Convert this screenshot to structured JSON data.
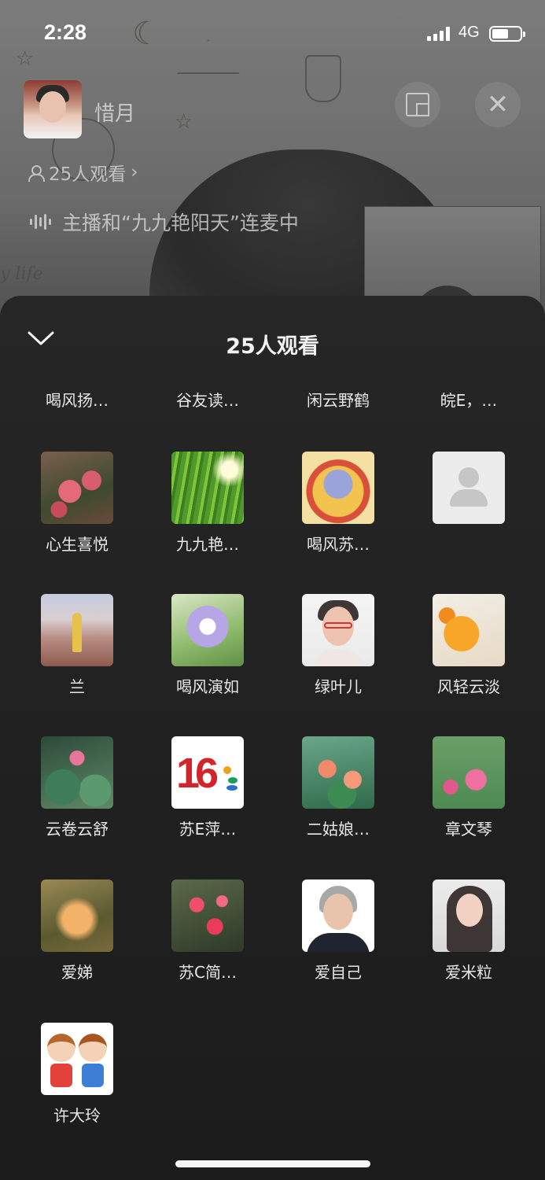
{
  "status_bar": {
    "time": "2:28",
    "network": "4G",
    "battery_level": 0.6
  },
  "live": {
    "host_name": "惜月",
    "viewer_count_text": "25人观看",
    "connect_status": "主播和“九九艳阳天”连麦中",
    "background_text": "y life"
  },
  "sheet": {
    "title": "25人观看",
    "top_row": [
      "喝风扬…",
      "谷友读…",
      "闲云野鹤",
      "皖E，…"
    ],
    "viewers": [
      {
        "name": "心生喜悦",
        "avatar": "pink-daisies-photo"
      },
      {
        "name": "九九艳…",
        "avatar": "green-grass-photo"
      },
      {
        "name": "喝风苏…",
        "avatar": "buddha-painting"
      },
      {
        "name": "",
        "avatar": "default-avatar-placeholder"
      },
      {
        "name": "兰",
        "avatar": "woman-in-field-photo"
      },
      {
        "name": "喝风演如",
        "avatar": "iris-flower-photo"
      },
      {
        "name": "绿叶儿",
        "avatar": "woman-with-glasses-photo"
      },
      {
        "name": "风轻云淡",
        "avatar": "orange-juice-photo"
      },
      {
        "name": "云卷云舒",
        "avatar": "lotus-pond-photo"
      },
      {
        "name": "苏E萍…",
        "avatar": "number-16-logo"
      },
      {
        "name": "二姑娘…",
        "avatar": "water-lily-photo"
      },
      {
        "name": "章文琴",
        "avatar": "lotus-field-photo"
      },
      {
        "name": "爱娣",
        "avatar": "child-painting"
      },
      {
        "name": "苏C简…",
        "avatar": "red-blossom-photo"
      },
      {
        "name": "爱自己",
        "avatar": "elderly-person-photo"
      },
      {
        "name": "爱米粒",
        "avatar": "young-woman-photo"
      },
      {
        "name": "许大玲",
        "avatar": "cartoon-couple"
      }
    ]
  }
}
